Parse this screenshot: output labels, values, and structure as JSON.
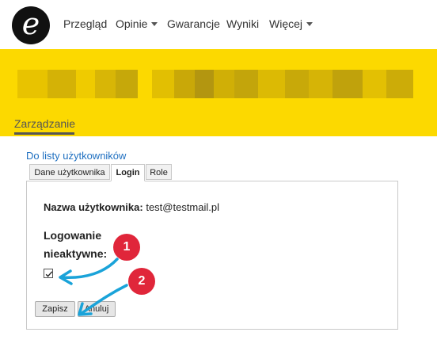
{
  "nav": {
    "logo_glyph": "e",
    "items": [
      {
        "label": "Przegląd",
        "dropdown": false
      },
      {
        "label": "Opinie",
        "dropdown": true
      },
      {
        "label": "Gwarancje",
        "dropdown": false
      },
      {
        "label": "Wyniki",
        "dropdown": false
      },
      {
        "label": "Więcej",
        "dropdown": true
      }
    ]
  },
  "banner": {
    "color": "#fcd900",
    "active_tab": "Zarządzanie"
  },
  "back_link": "Do listy użytkowników",
  "tabs": [
    {
      "label": "Dane użytkownika",
      "active": false
    },
    {
      "label": "Login",
      "active": true
    },
    {
      "label": "Role",
      "active": false
    }
  ],
  "form": {
    "username_label": "Nazwa użytkownika:",
    "username_value": "test@testmail.pl",
    "inactive_label": "Logowanie nieaktywne:",
    "inactive_checked": true,
    "save_label": "Zapisz",
    "cancel_label": "Anuluj"
  },
  "annotations": {
    "badge_1": "1",
    "badge_2": "2",
    "badge_color": "#e0263a",
    "arrow_color": "#1aa3d9"
  }
}
